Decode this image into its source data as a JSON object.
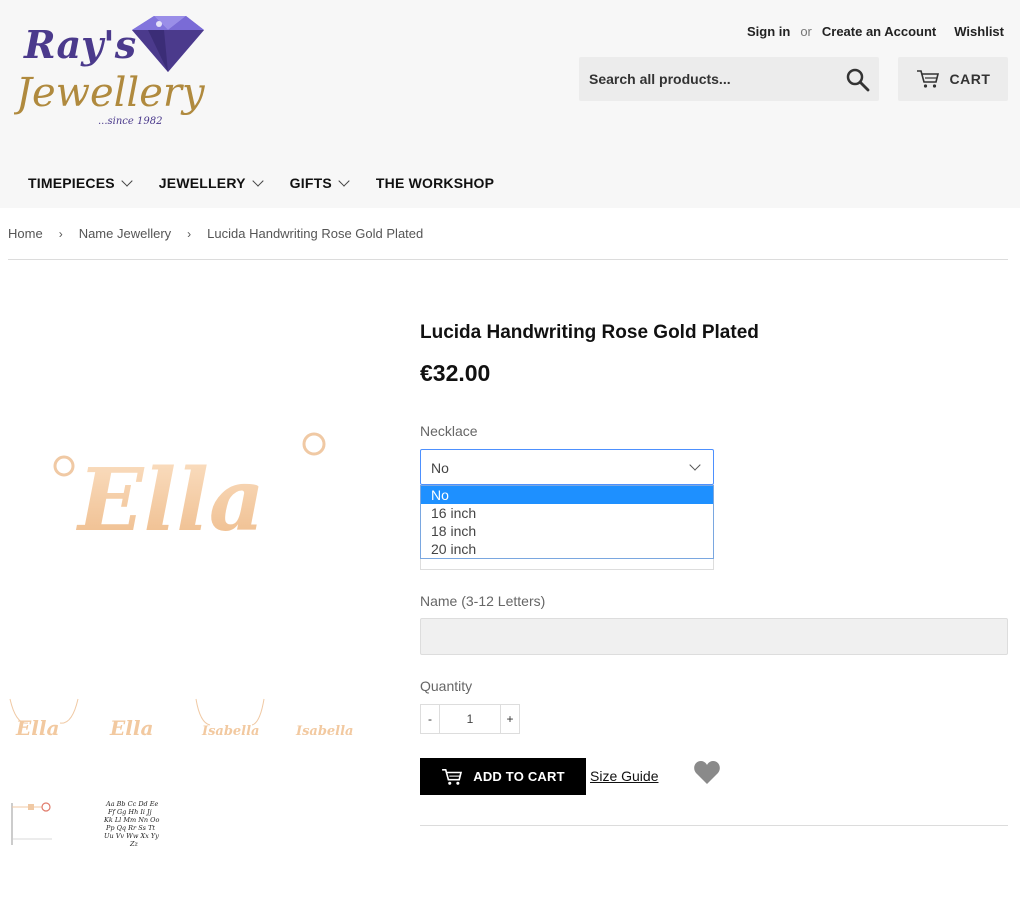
{
  "brand": {
    "logo_line1": "Ray's",
    "logo_line2": "Jewellery",
    "logo_tagline": "...since 1982"
  },
  "account": {
    "sign_in": "Sign in",
    "or": "or",
    "create_account": "Create an Account",
    "wishlist": "Wishlist"
  },
  "search": {
    "placeholder": "Search all products..."
  },
  "cart": {
    "label": "CART"
  },
  "nav": {
    "items": [
      {
        "label": "TIMEPIECES",
        "has_dropdown": true
      },
      {
        "label": "JEWELLERY",
        "has_dropdown": true
      },
      {
        "label": "GIFTS",
        "has_dropdown": true
      },
      {
        "label": "THE WORKSHOP",
        "has_dropdown": false
      }
    ]
  },
  "breadcrumb": {
    "items": [
      "Home",
      "Name Jewellery",
      "Lucida Handwriting Rose Gold Plated"
    ],
    "separator": "›"
  },
  "product": {
    "title": "Lucida Handwriting Rose Gold Plated",
    "price": "€32.00",
    "image_name": "Ella",
    "necklace_label": "Necklace",
    "necklace_value": "No",
    "necklace_options": [
      "No",
      "16 inch",
      "18 inch",
      "20 inch"
    ],
    "name_label": "Name (3-12 Letters)",
    "quantity_label": "Quantity",
    "quantity_value": "1",
    "qty_minus": "-",
    "qty_plus": "+",
    "add_to_cart": "ADD TO CART",
    "size_guide": "Size Guide",
    "thumbnails": [
      "Ella",
      "Ella",
      "Isabella",
      "Isabella"
    ]
  },
  "colors": {
    "header_bg": "#f7f7f7",
    "logo_purple": "#4b3a8c",
    "logo_gold": "#b08a3e",
    "rose_gold": "#f2c9a0",
    "select_highlight": "#1e90ff",
    "add_to_cart_bg": "#000000"
  }
}
